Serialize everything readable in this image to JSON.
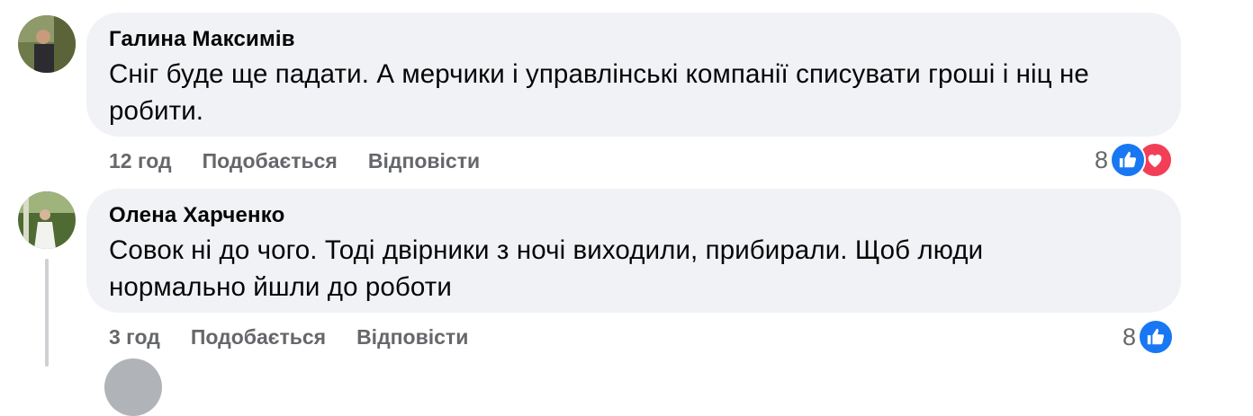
{
  "comments": [
    {
      "author": "Галина Максимів",
      "text_lines": [
        "Сніг буде ще падати. А мерчики і управлінські компанії списувати гроші і ніц не",
        "робити."
      ],
      "time": "12 год",
      "like_label": "Подобається",
      "reply_label": "Відповісти",
      "reaction_count": "8",
      "reaction_icons": [
        "like-icon",
        "love-icon"
      ]
    },
    {
      "author": "Олена Харченко",
      "text_lines": [
        "Совок ні до чого. Тоді двірники з ночі виходили, прибирали. Щоб люди",
        "нормально йшли до роботи"
      ],
      "time": "3 год",
      "like_label": "Подобається",
      "reply_label": "Відповісти",
      "reaction_count": "8",
      "reaction_icons": [
        "like-icon"
      ]
    }
  ],
  "colors": {
    "bubble": "#f0f2f5",
    "meta_text": "#65676b",
    "like": "#1877f2",
    "love": "#f33e58"
  }
}
